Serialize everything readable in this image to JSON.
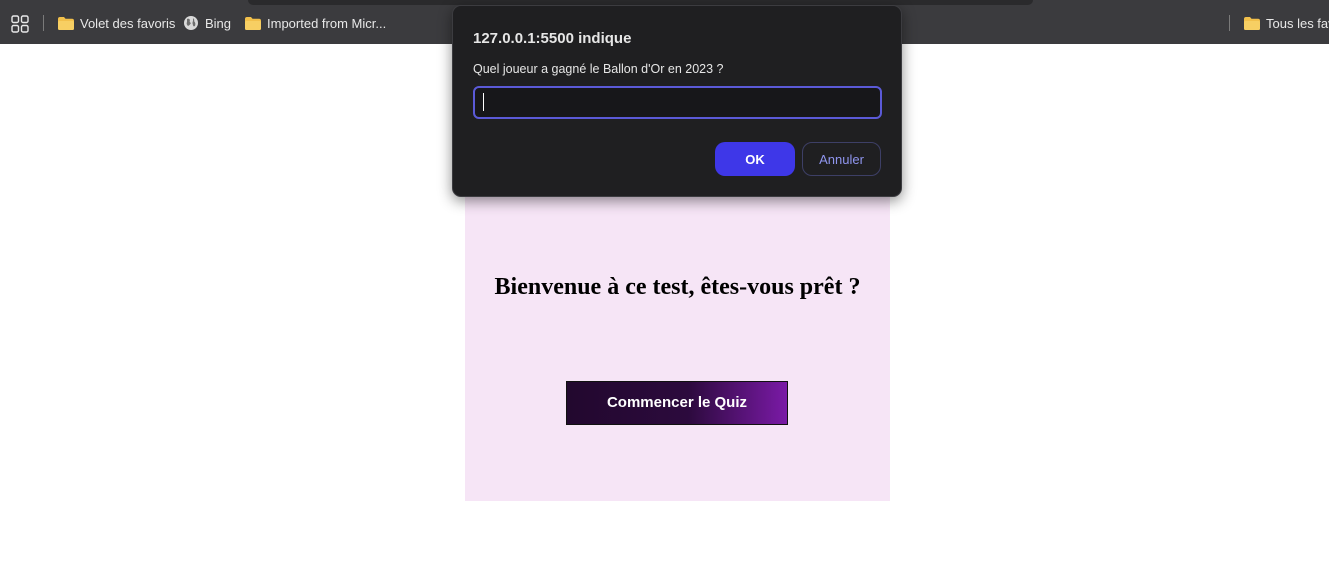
{
  "favorites_bar": {
    "items": [
      {
        "label": "Volet des favoris",
        "icon": "folder-icon"
      },
      {
        "label": "Bing",
        "icon": "globe-icon"
      },
      {
        "label": "Imported from Micr...",
        "icon": "folder-icon"
      }
    ],
    "right_item": {
      "label": "Tous les favoris",
      "icon": "folder-icon"
    }
  },
  "dialog": {
    "title": "127.0.0.1:5500 indique",
    "message": "Quel joueur a gagné le Ballon d'Or en 2023 ?",
    "input_value": "",
    "ok_label": "OK",
    "cancel_label": "Annuler"
  },
  "page": {
    "heading": "Bienvenue à ce test, êtes-vous prêt ?",
    "start_button_label": "Commencer le Quiz"
  },
  "colors": {
    "card_background": "#f6e5f6",
    "ok_button": "#3e37e8",
    "input_focus_border": "#5b5ad8",
    "folder": "#f2c04b"
  }
}
